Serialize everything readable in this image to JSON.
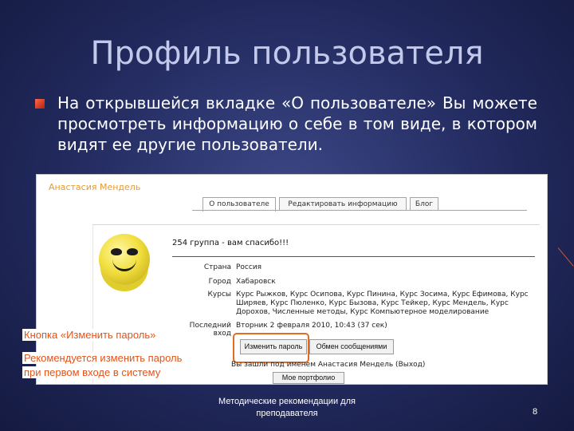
{
  "slide": {
    "title": "Профиль пользователя",
    "body": "На открывшейся вкладке «О пользователе» Вы можете просмотреть информацию о себе в том виде, в котором видят ее другие пользователи.",
    "footer_line1": "Методические рекомендации для",
    "footer_line2": "преподавателя",
    "page_number": "8"
  },
  "screenshot": {
    "profile_name": "Анастасия Мендель",
    "tabs": [
      "О пользователе",
      "Редактировать информацию",
      "Блог"
    ],
    "greeting": "254 группа - вам спасибо!!!",
    "rows": [
      {
        "label": "Страна",
        "value": "Россия"
      },
      {
        "label": "Город",
        "value": "Хабаровск"
      },
      {
        "label": "Курсы",
        "value": "Курс Рыжков, Курс Осипова, Курс Пинина, Курс Зосима, Курс Ефимова, Курс Ширяев, Курс Пюленко, Курс Бызова, Курс Тейкер, Курс Мендель, Курс Дорохов, Численные методы, Курс Компьютерное моделирование"
      },
      {
        "label": "Последний вход",
        "value": "Вторник 2 февраля 2010, 10:43 (37 сек)"
      }
    ],
    "buttons": {
      "change_password": "Изменить пароль",
      "messages": "Обмен сообщениями",
      "my_portfolio": "Мое портфолио"
    },
    "logged_in": "Вы зашли под именем Анастасия Мендель (Выход)"
  },
  "callouts": {
    "change_password": "Кнопка «Изменить пароль»",
    "recommend_line1": "Рекомендуется изменить пароль",
    "recommend_line2": "при первом входе в систему"
  },
  "colors": {
    "background": "#2a3470",
    "title": "#c3c9ea",
    "accent": "#e46b23",
    "profile_name": "#e89a31"
  }
}
